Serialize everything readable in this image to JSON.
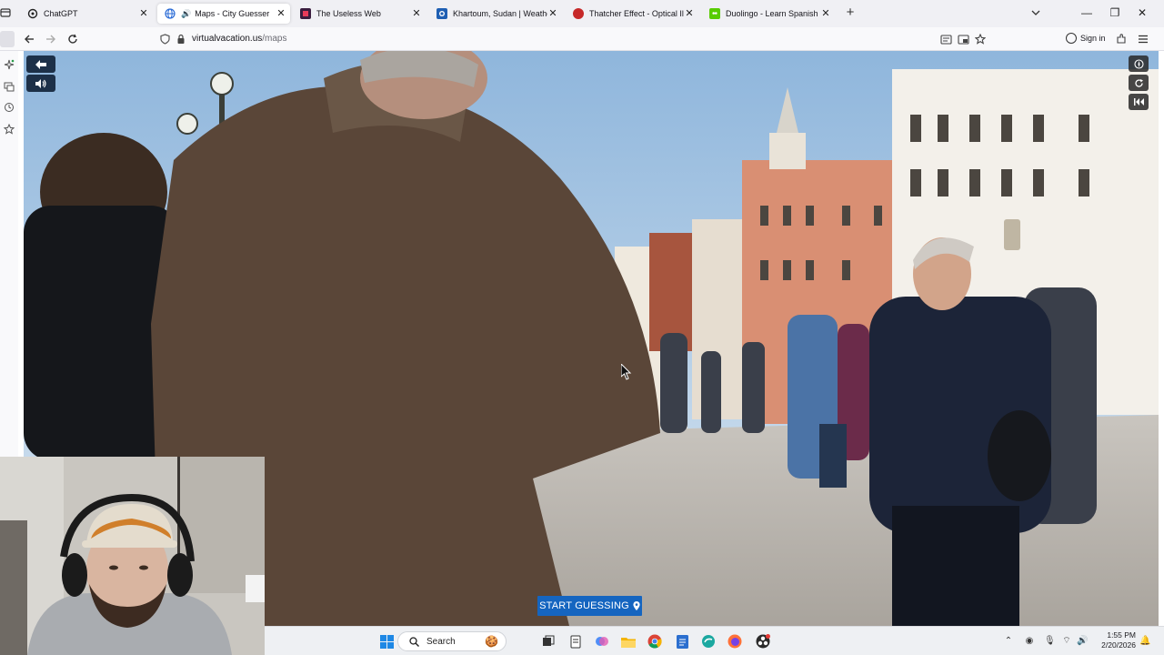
{
  "browser": {
    "tabs": [
      {
        "title": "ChatGPT",
        "favicon": "chatgpt-icon",
        "active": false
      },
      {
        "title": "Maps - City Guesser",
        "favicon": "globe-icon",
        "active": true,
        "audio": true
      },
      {
        "title": "The Useless Web",
        "favicon": "useless-web-icon",
        "active": false
      },
      {
        "title": "Khartoum, Sudan | Weather Sat",
        "favicon": "weather-icon",
        "active": false
      },
      {
        "title": "Thatcher Effect - Optical Illusio",
        "favicon": "illusion-icon",
        "active": false
      },
      {
        "title": "Duolingo - Learn Spanish with L",
        "favicon": "duolingo-icon",
        "active": false
      }
    ],
    "url_host": "virtualvacation.us",
    "url_path": "/maps",
    "signin_label": "Sign in"
  },
  "game": {
    "start_label": "START GUESSING"
  },
  "taskbar": {
    "search_label": "Search",
    "time": "1:55 PM",
    "date": "2/20/2026"
  },
  "colors": {
    "start_button": "#1565c0",
    "nav_button": "#1d3048",
    "active_tab": "#ffffff",
    "tabstrip": "#f0f0f4"
  }
}
